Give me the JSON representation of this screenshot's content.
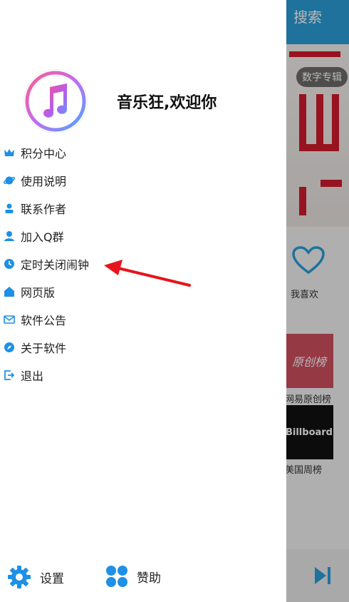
{
  "background": {
    "topbar_title": "搜索",
    "banner_tag": "数字专辑",
    "like_label": "我喜欢",
    "tile1_text": "原创榜",
    "tile1_label": "网易原创榜",
    "tile2_text": "Billboard",
    "tile2_label": "美国周榜"
  },
  "drawer": {
    "welcome": "音乐狂,欢迎你",
    "menu": [
      {
        "label": "积分中心",
        "icon": "crown-icon"
      },
      {
        "label": "使用说明",
        "icon": "planet-icon"
      },
      {
        "label": "联系作者",
        "icon": "person-icon"
      },
      {
        "label": "加入Q群",
        "icon": "user-group-icon"
      },
      {
        "label": "定时关闭闹钟",
        "icon": "clock-icon"
      },
      {
        "label": "网页版",
        "icon": "home-icon"
      },
      {
        "label": "软件公告",
        "icon": "mail-icon"
      },
      {
        "label": "关于软件",
        "icon": "compass-icon"
      },
      {
        "label": "退出",
        "icon": "exit-icon"
      }
    ],
    "bottom": {
      "settings_label": "设置",
      "sponsor_label": "赞助"
    }
  },
  "colors": {
    "accent": "#1e90e6",
    "topbar": "#2a9fd8",
    "annotation_arrow": "#e8141c"
  }
}
